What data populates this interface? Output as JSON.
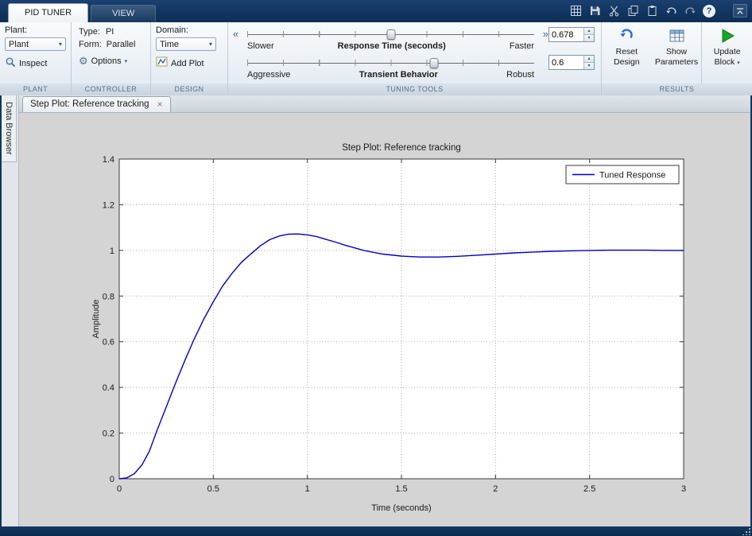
{
  "glyphs": {
    "dropdown_arrow": "▾",
    "left_arrows": "«",
    "right_arrows": "»",
    "spinner_up": "▴",
    "spinner_down": "▾",
    "close": "×",
    "help": "?",
    "gear": "⚙",
    "play": "▶"
  },
  "colors": {
    "titlebar_blue": "#0d2e55",
    "curve_blue": "#0000CC",
    "ribbon_footer_text": "#5a6e82",
    "update_green": "#1fa32a"
  },
  "app_tabs": [
    {
      "label": "PID TUNER",
      "active": true
    },
    {
      "label": "VIEW",
      "active": false
    }
  ],
  "quick_access": {
    "icons": [
      "layout-grid",
      "save",
      "cut",
      "copy",
      "paste",
      "undo",
      "redo",
      "help",
      "minimize-ribbon"
    ]
  },
  "ribbon": {
    "plant": {
      "label": "Plant:",
      "dropdown_value": "Plant",
      "inspect_label": "Inspect",
      "section": "PLANT"
    },
    "controller": {
      "type_label": "Type:",
      "type_value": "PI",
      "form_label": "Form:",
      "form_value": "Parallel",
      "options_label": "Options",
      "section": "CONTROLLER"
    },
    "design": {
      "domain_label": "Domain:",
      "domain_value": "Time",
      "add_plot_label": "Add Plot",
      "section": "DESIGN"
    },
    "tuning": {
      "sliders": [
        {
          "left": "Slower",
          "center": "Response Time (seconds)",
          "right": "Faster",
          "handle_pos": 0.5
        },
        {
          "left": "Aggressive",
          "center": "Transient Behavior",
          "right": "Robust",
          "handle_pos": 0.65
        }
      ],
      "response_time_value": "0.678",
      "transient_value": "0.6",
      "section": "TUNING TOOLS"
    },
    "results": {
      "buttons": [
        {
          "line1": "Reset",
          "line2": "Design"
        },
        {
          "line1": "Show",
          "line2": "Parameters"
        },
        {
          "line1": "Update",
          "line2": "Block",
          "has_menu": true
        }
      ],
      "section": "RESULTS"
    }
  },
  "sidebar": {
    "label": "Data Browser"
  },
  "doc_tab": {
    "label": "Step Plot: Reference tracking"
  },
  "chart_data": {
    "type": "line",
    "title": "Step Plot: Reference tracking",
    "xlabel": "Time (seconds)",
    "ylabel": "Amplitude",
    "xlim": [
      0,
      3
    ],
    "ylim": [
      0,
      1.4
    ],
    "xticks": [
      0,
      0.5,
      1,
      1.5,
      2,
      2.5,
      3
    ],
    "yticks": [
      0,
      0.2,
      0.4,
      0.6,
      0.8,
      1,
      1.2,
      1.4
    ],
    "grid": true,
    "legend": {
      "position": "top-right"
    },
    "series": [
      {
        "name": "Tuned Response",
        "color": "#0000CC",
        "points": [
          [
            0,
            0
          ],
          [
            0.04,
            0.004
          ],
          [
            0.08,
            0.022
          ],
          [
            0.12,
            0.06
          ],
          [
            0.16,
            0.12
          ],
          [
            0.2,
            0.21
          ],
          [
            0.25,
            0.315
          ],
          [
            0.3,
            0.42
          ],
          [
            0.35,
            0.52
          ],
          [
            0.4,
            0.615
          ],
          [
            0.45,
            0.7
          ],
          [
            0.5,
            0.775
          ],
          [
            0.55,
            0.845
          ],
          [
            0.6,
            0.9
          ],
          [
            0.65,
            0.948
          ],
          [
            0.7,
            0.985
          ],
          [
            0.75,
            1.02
          ],
          [
            0.8,
            1.047
          ],
          [
            0.85,
            1.063
          ],
          [
            0.9,
            1.071
          ],
          [
            0.95,
            1.072
          ],
          [
            1.0,
            1.068
          ],
          [
            1.05,
            1.06
          ],
          [
            1.1,
            1.048
          ],
          [
            1.15,
            1.036
          ],
          [
            1.2,
            1.023
          ],
          [
            1.3,
            1.0
          ],
          [
            1.4,
            0.984
          ],
          [
            1.5,
            0.975
          ],
          [
            1.6,
            0.971
          ],
          [
            1.7,
            0.971
          ],
          [
            1.8,
            0.974
          ],
          [
            1.9,
            0.979
          ],
          [
            2.0,
            0.984
          ],
          [
            2.1,
            0.989
          ],
          [
            2.2,
            0.993
          ],
          [
            2.3,
            0.996
          ],
          [
            2.4,
            0.998
          ],
          [
            2.5,
            1.0
          ],
          [
            2.6,
            1.001
          ],
          [
            2.7,
            1.001
          ],
          [
            2.8,
            1.001
          ],
          [
            2.9,
            1.0
          ],
          [
            3.0,
            1.0
          ]
        ]
      }
    ]
  }
}
